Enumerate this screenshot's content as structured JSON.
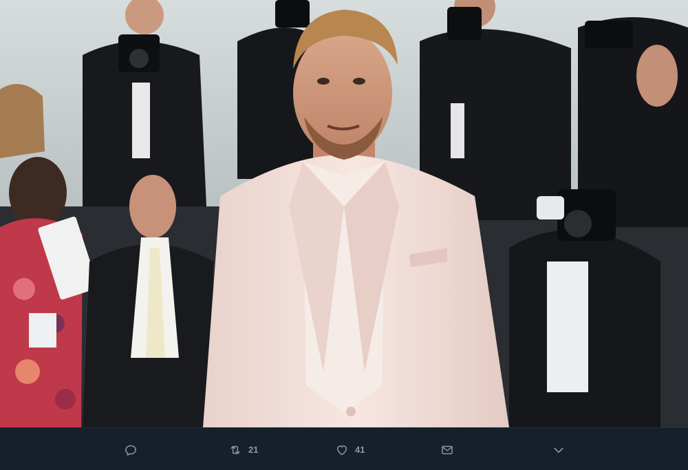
{
  "photo": {
    "subject": "photo",
    "colors": {
      "background_wall": "#c8cfd0",
      "suit": "#f4e1dc",
      "shirt": "#f6ece7",
      "dark_suits": "#15171b",
      "dress": "#c0394a"
    }
  },
  "actions": {
    "reply": {
      "icon": "reply-icon",
      "count": ""
    },
    "retweet": {
      "icon": "retweet-icon",
      "count": "21"
    },
    "like": {
      "icon": "heart-icon",
      "count": "41"
    },
    "share": {
      "icon": "mail-icon",
      "count": ""
    },
    "more": {
      "icon": "chevron-down-icon",
      "count": ""
    }
  },
  "colors": {
    "action_bar_bg": "#15202b",
    "icon_gray": "#8899a6"
  }
}
